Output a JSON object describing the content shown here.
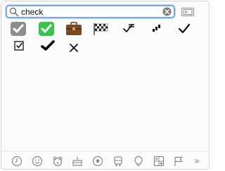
{
  "search": {
    "value": "check",
    "placeholder": "Search"
  },
  "results": [
    {
      "name": "heavy-check-mark-grey-icon"
    },
    {
      "name": "white-heavy-check-mark-green-icon"
    },
    {
      "name": "briefcase-icon"
    },
    {
      "name": "checkered-flag-icon"
    },
    {
      "name": "check-mark-with-tick-icon"
    },
    {
      "name": "small-checks-icon"
    },
    {
      "name": "check-mark-icon"
    },
    {
      "name": "ballot-box-with-check-icon"
    },
    {
      "name": "heavy-check-mark-black-icon"
    },
    {
      "name": "multiplication-x-icon"
    }
  ],
  "category_tabs": [
    {
      "name": "frequently-used-clock-icon"
    },
    {
      "name": "smileys-icon"
    },
    {
      "name": "animals-bear-icon"
    },
    {
      "name": "food-cake-icon"
    },
    {
      "name": "activity-ball-icon"
    },
    {
      "name": "travel-car-icon"
    },
    {
      "name": "objects-lightbulb-icon"
    },
    {
      "name": "symbols-icon"
    },
    {
      "name": "flags-icon"
    }
  ],
  "more_label": "»",
  "colors": {
    "search_border": "#7ea6e6",
    "check_green": "#38c446",
    "icon_grey": "#8a8a8a"
  }
}
